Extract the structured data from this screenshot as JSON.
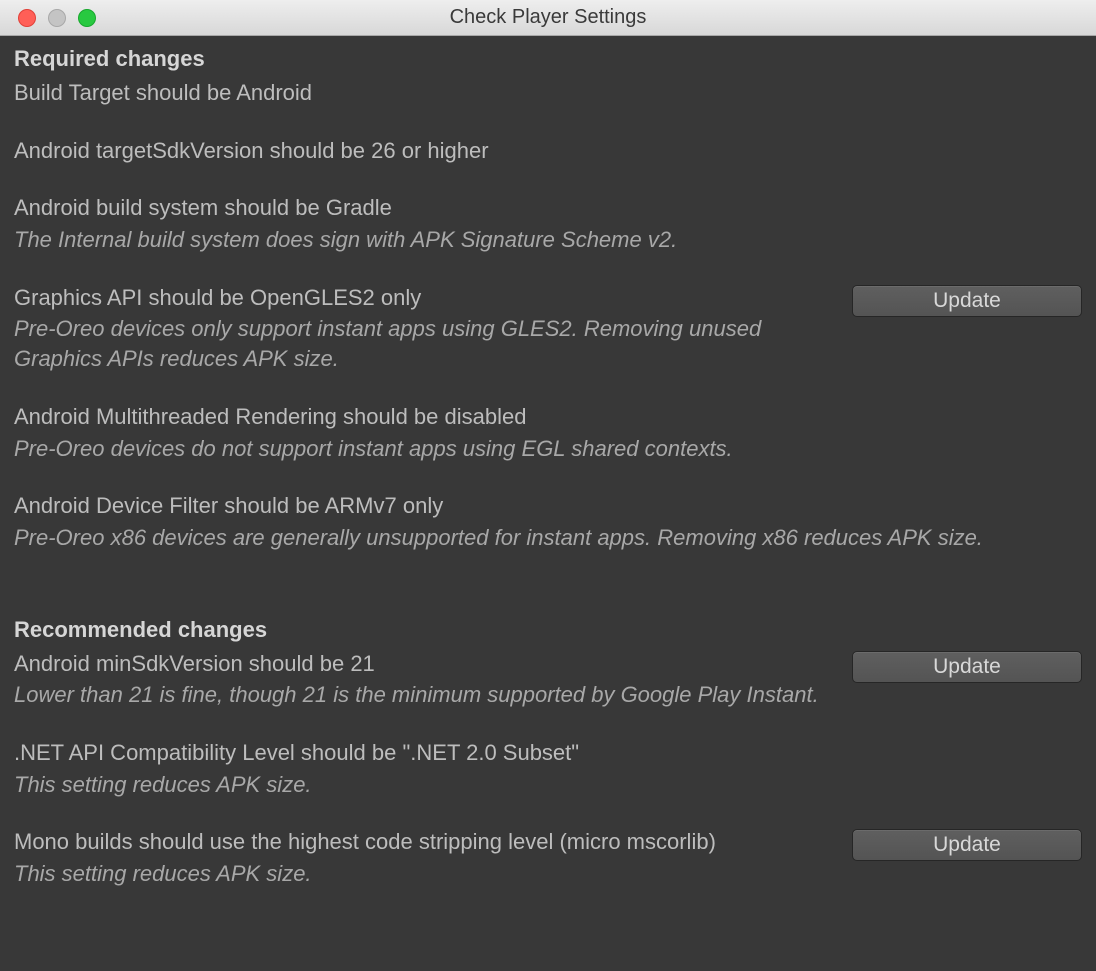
{
  "window": {
    "title": "Check Player Settings"
  },
  "sections": {
    "required": {
      "heading": "Required changes",
      "items": [
        {
          "title": "Build Target should be Android",
          "note": null,
          "button": null
        },
        {
          "title": "Android targetSdkVersion should be 26 or higher",
          "note": null,
          "button": null
        },
        {
          "title": "Android build system should be Gradle",
          "note": "The Internal build system does sign with APK Signature Scheme v2.",
          "button": null
        },
        {
          "title": "Graphics API should be OpenGLES2 only",
          "note": "Pre-Oreo devices only support instant apps using GLES2. Removing unused Graphics APIs reduces APK size.",
          "button": "Update"
        },
        {
          "title": "Android Multithreaded Rendering should be disabled",
          "note": "Pre-Oreo devices do not support instant apps using EGL shared contexts.",
          "button": null
        },
        {
          "title": "Android Device Filter should be ARMv7 only",
          "note": "Pre-Oreo x86 devices are generally unsupported for instant apps. Removing x86 reduces APK size.",
          "button": null
        }
      ]
    },
    "recommended": {
      "heading": "Recommended changes",
      "items": [
        {
          "title": "Android minSdkVersion should be 21",
          "note": "Lower than 21 is fine, though 21 is the minimum supported by Google Play Instant.",
          "button": "Update"
        },
        {
          "title": ".NET API Compatibility Level should be \".NET 2.0 Subset\"",
          "note": "This setting reduces APK size.",
          "button": null
        },
        {
          "title": "Mono builds should use the highest code stripping level (micro mscorlib)",
          "note": "This setting reduces APK size.",
          "button": "Update"
        }
      ]
    }
  }
}
